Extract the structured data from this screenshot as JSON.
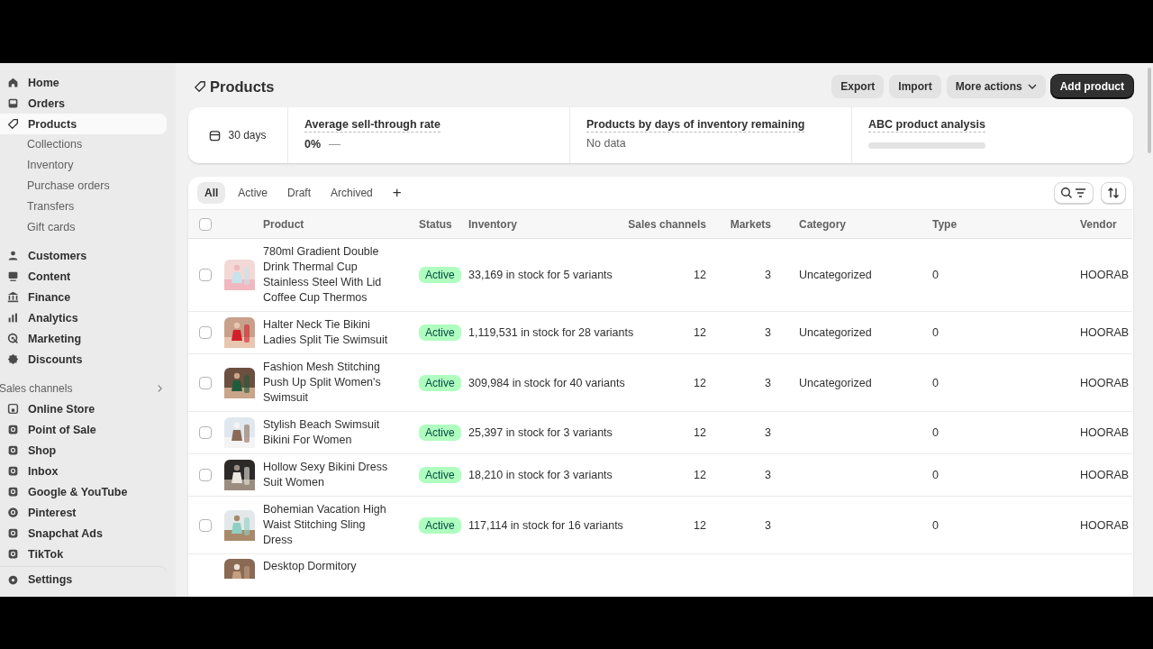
{
  "sidebar": {
    "items": [
      {
        "label": "Home",
        "selected": false
      },
      {
        "label": "Orders",
        "selected": false
      },
      {
        "label": "Products",
        "selected": true,
        "children": [
          {
            "label": "Collections",
            "selected": false
          },
          {
            "label": "Inventory",
            "selected": false
          },
          {
            "label": "Purchase orders",
            "selected": false
          },
          {
            "label": "Transfers",
            "selected": false
          },
          {
            "label": "Gift cards",
            "selected": false
          }
        ]
      },
      {
        "label": "Customers",
        "selected": false
      },
      {
        "label": "Content",
        "selected": false
      },
      {
        "label": "Finance",
        "selected": false
      },
      {
        "label": "Analytics",
        "selected": false
      },
      {
        "label": "Marketing",
        "selected": false
      },
      {
        "label": "Discounts",
        "selected": false
      }
    ],
    "section_title": "Sales channels",
    "channels": [
      {
        "label": "Online Store"
      },
      {
        "label": "Point of Sale"
      },
      {
        "label": "Shop"
      },
      {
        "label": "Inbox"
      },
      {
        "label": "Google & YouTube"
      },
      {
        "label": "Pinterest"
      },
      {
        "label": "Snapchat Ads"
      },
      {
        "label": "TikTok"
      }
    ],
    "footer": {
      "label": "Settings"
    }
  },
  "page": {
    "title": "Products",
    "actions": [
      {
        "label": "Export",
        "kind": "secondary"
      },
      {
        "label": "Import",
        "kind": "secondary"
      },
      {
        "label": "More actions",
        "kind": "menu"
      },
      {
        "label": "Add product",
        "kind": "primary"
      }
    ]
  },
  "metrics": {
    "period": "30 days",
    "cards": [
      {
        "kind": "value",
        "title": "Average sell-through rate",
        "value": "0%",
        "delta": "—"
      },
      {
        "kind": "value",
        "title": "Products by days of inventory remaining",
        "value": "No data"
      },
      {
        "kind": "loading",
        "title": "ABC product analysis"
      }
    ]
  },
  "tabs": [
    {
      "label": "All",
      "selected": true
    },
    {
      "label": "Active",
      "selected": false
    },
    {
      "label": "Draft",
      "selected": false
    },
    {
      "label": "Archived",
      "selected": false
    }
  ],
  "add_tab": "+",
  "table": {
    "select_all_checked": false,
    "columns": [
      "Product",
      "Status",
      "Inventory",
      "Sales channels",
      "Markets",
      "Category",
      "Type",
      "Vendor"
    ],
    "rows": [
      {
        "checked": false,
        "product": "780ml Gradient Double Drink Thermal Cup Stainless Steel With Lid Coffee Cup Thermos",
        "status": "Active",
        "inventory": "33,169 in stock for 5 variants",
        "sales_channels": "12",
        "markets": "3",
        "category": "Uncategorized",
        "type": "0",
        "vendor": "HOORAB"
      },
      {
        "checked": false,
        "product": "Halter Neck Tie Bikini Ladies Split Tie Swimsuit",
        "status": "Active",
        "inventory": "1,119,531 in stock for 28 variants",
        "sales_channels": "12",
        "markets": "3",
        "category": "Uncategorized",
        "type": "0",
        "vendor": "HOORAB"
      },
      {
        "checked": false,
        "product": "Fashion Mesh Stitching Push Up Split Women's Swimsuit",
        "status": "Active",
        "inventory": "309,984 in stock for 40 variants",
        "sales_channels": "12",
        "markets": "3",
        "category": "Uncategorized",
        "type": "0",
        "vendor": "HOORAB"
      },
      {
        "checked": false,
        "product": "Stylish Beach Swimsuit Bikini For Women",
        "status": "Active",
        "inventory": "25,397 in stock for 3 variants",
        "sales_channels": "12",
        "markets": "3",
        "type": "0",
        "vendor": "HOORAB"
      },
      {
        "checked": false,
        "product": "Hollow Sexy Bikini Dress Suit Women",
        "status": "Active",
        "inventory": "18,210 in stock for 3 variants",
        "sales_channels": "12",
        "markets": "3",
        "type": "0",
        "vendor": "HOORAB"
      },
      {
        "checked": false,
        "product": "Bohemian Vacation High Waist Stitching Sling Dress",
        "status": "Active",
        "inventory": "117,114 in stock for 16 variants",
        "sales_channels": "12",
        "markets": "3",
        "type": "0",
        "vendor": "HOORAB"
      },
      {
        "product": "Desktop Dormitory"
      }
    ]
  }
}
